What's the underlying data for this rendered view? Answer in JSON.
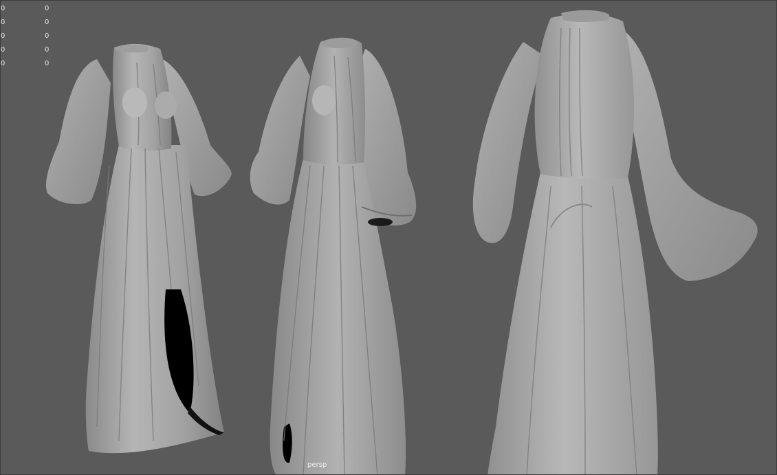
{
  "hud": {
    "rows": [
      {
        "a": "0",
        "b": "0"
      },
      {
        "a": "0",
        "b": "0"
      },
      {
        "a": "0",
        "b": "0"
      },
      {
        "a": "0",
        "b": "0"
      },
      {
        "a": "0",
        "b": "0"
      }
    ]
  },
  "camera_label": "persp",
  "colors": {
    "background": "#5a5a5a",
    "cloth": "#a9a9a9",
    "cloth_shadow": "#7d7d7d",
    "cloth_highlight": "#c4c4c4",
    "cavity": "#000000"
  }
}
